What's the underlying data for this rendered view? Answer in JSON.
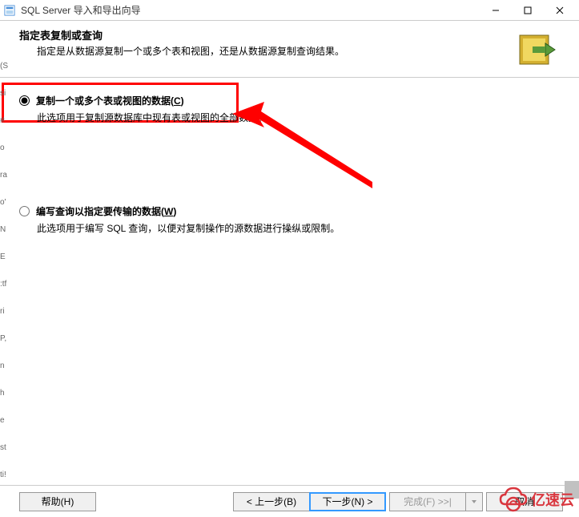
{
  "titlebar": {
    "title": "SQL Server 导入和导出向导"
  },
  "header": {
    "title": "指定表复制或查询",
    "subtitle": "指定是从数据源复制一个或多个表和视图，还是从数据源复制查询结果。"
  },
  "options": {
    "copy": {
      "label": "复制一个或多个表或视图的数据(",
      "accelerator": "C",
      "label_suffix": ")",
      "description": "此选项用于复制源数据库中现有表或视图的全部数据。"
    },
    "query": {
      "label": "编写查询以指定要传输的数据(",
      "accelerator": "W",
      "label_suffix": ")",
      "description": "此选项用于编写 SQL 查询，以便对复制操作的源数据进行操纵或限制。"
    }
  },
  "footer": {
    "help": "帮助(H)",
    "back": "< 上一步(B)",
    "next": "下一步(N) >",
    "finish": "完成(F) >>|",
    "cancel": "取消"
  },
  "watermark": {
    "text": "亿速云"
  },
  "left_edge_chars": [
    "(S",
    "",
    "si",
    "",
    "#",
    "",
    "o",
    "ra",
    "",
    "o'",
    "N",
    "E",
    ":tf",
    "ri",
    "P,",
    "n",
    "",
    "h",
    "e",
    "st",
    "ti!"
  ]
}
